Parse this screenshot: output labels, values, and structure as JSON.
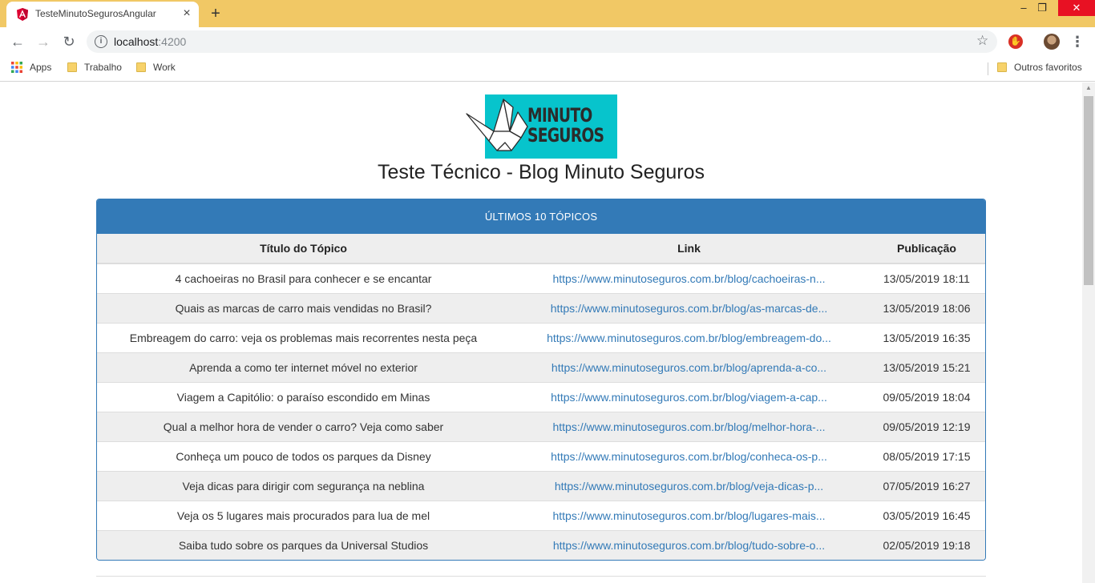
{
  "browser": {
    "tab_title": "TesteMinutoSegurosAngular",
    "url_host": "localhost",
    "url_port": ":4200",
    "window": {
      "minimize": "–",
      "maximize": "❐",
      "close": "✕"
    },
    "bookmarks": {
      "apps": "Apps",
      "trabalho": "Trabalho",
      "work": "Work",
      "outros": "Outros favoritos"
    }
  },
  "page": {
    "logo": {
      "line1": "MINUTO",
      "line2": "SEGUROS",
      "bg_color": "#07c4cc"
    },
    "title": "Teste Técnico - Blog Minuto Seguros",
    "card": {
      "header": "ÚLTIMOS 10 TÓPICOS",
      "accent_color": "#337ab7",
      "columns": [
        "Título do Tópico",
        "Link",
        "Publicação"
      ],
      "rows": [
        {
          "title": "4 cachoeiras no Brasil para conhecer e se encantar",
          "link": "https://www.minutoseguros.com.br/blog/cachoeiras-n...",
          "date": "13/05/2019 18:11"
        },
        {
          "title": "Quais as marcas de carro mais vendidas no Brasil?",
          "link": "https://www.minutoseguros.com.br/blog/as-marcas-de...",
          "date": "13/05/2019 18:06"
        },
        {
          "title": "Embreagem do carro: veja os problemas mais recorrentes nesta peça",
          "link": "https://www.minutoseguros.com.br/blog/embreagem-do...",
          "date": "13/05/2019 16:35"
        },
        {
          "title": "Aprenda a como ter internet móvel no exterior",
          "link": "https://www.minutoseguros.com.br/blog/aprenda-a-co...",
          "date": "13/05/2019 15:21"
        },
        {
          "title": "Viagem a Capitólio: o paraíso escondido em Minas",
          "link": "https://www.minutoseguros.com.br/blog/viagem-a-cap...",
          "date": "09/05/2019 18:04"
        },
        {
          "title": "Qual a melhor hora de vender o carro? Veja como saber",
          "link": "https://www.minutoseguros.com.br/blog/melhor-hora-...",
          "date": "09/05/2019 12:19"
        },
        {
          "title": "Conheça um pouco de todos os parques da Disney",
          "link": "https://www.minutoseguros.com.br/blog/conheca-os-p...",
          "date": "08/05/2019 17:15"
        },
        {
          "title": "Veja dicas para dirigir com segurança na neblina",
          "link": "https://www.minutoseguros.com.br/blog/veja-dicas-p...",
          "date": "07/05/2019 16:27"
        },
        {
          "title": "Veja os 5 lugares mais procurados para lua de mel",
          "link": "https://www.minutoseguros.com.br/blog/lugares-mais...",
          "date": "03/05/2019 16:45"
        },
        {
          "title": "Saiba tudo sobre os parques da Universal Studios",
          "link": "https://www.minutoseguros.com.br/blog/tudo-sobre-o...",
          "date": "02/05/2019 19:18"
        }
      ]
    }
  }
}
